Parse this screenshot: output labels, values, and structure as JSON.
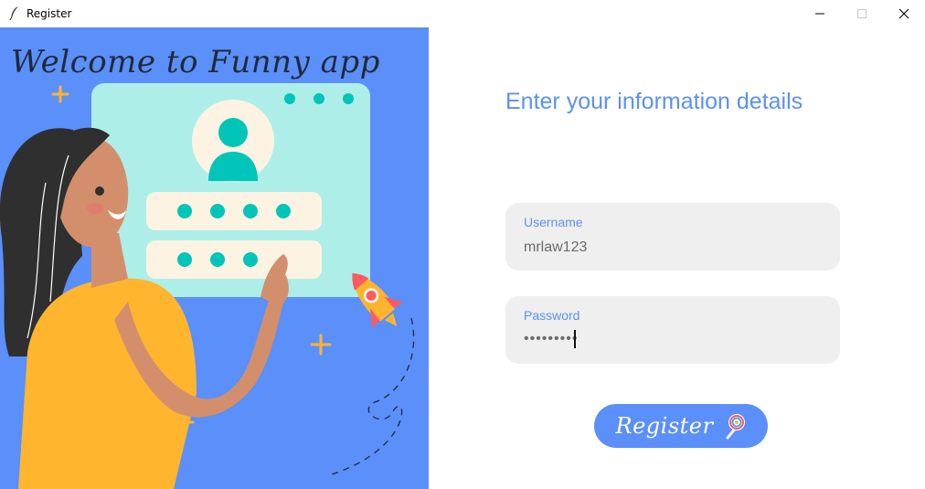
{
  "window": {
    "title": "Register",
    "controls": [
      "minimize",
      "maximize",
      "close"
    ]
  },
  "illustration": {
    "heading": "Welcome to Funny app",
    "colors": {
      "background": "#5b8ff9",
      "card": "#aeeee8",
      "accent": "#00c5b8",
      "shirt": "#ffb52e",
      "hair": "#2f2f2f",
      "skin": "#d38f6c"
    },
    "icons": [
      "user-avatar-icon",
      "rocket-icon",
      "plus-sign-icon"
    ]
  },
  "form": {
    "heading": "Enter your information details",
    "username": {
      "label": "Username",
      "value": "mrlaw123"
    },
    "password": {
      "label": "Password",
      "value": "•••••••••"
    },
    "register_button": {
      "label": "Register",
      "icon": "lollipop-icon"
    }
  },
  "theme": {
    "accent": "#5b8ff9",
    "field_bg": "#efefef",
    "label": "#5b8ff9"
  }
}
